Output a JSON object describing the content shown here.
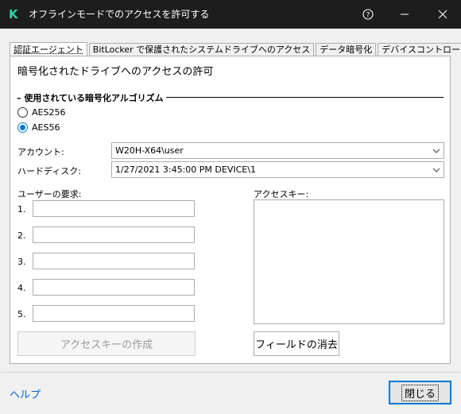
{
  "window": {
    "title": "オフラインモードでのアクセスを許可する",
    "app_logo": "K"
  },
  "tabs": [
    {
      "label": "認証エージェント",
      "active": true
    },
    {
      "label": "BitLocker で保護されたシステムドライブへのアクセス",
      "active": false
    },
    {
      "label": "データ暗号化",
      "active": false
    },
    {
      "label": "デバイスコントロール",
      "active": false
    }
  ],
  "panel": {
    "heading": "暗号化されたドライブへのアクセスの許可",
    "algorithm_group": {
      "title": "使用されている暗号化アルゴリズム",
      "options": [
        {
          "label": "AES256",
          "checked": false
        },
        {
          "label": "AES56",
          "checked": true
        }
      ]
    },
    "account": {
      "label": "アカウント:",
      "value": "W20H-X64\\user"
    },
    "hard_disk": {
      "label": "ハードディスク:",
      "value": "1/27/2021 3:45:00 PM  DEVICE\\1"
    },
    "user_request": {
      "label": "ユーザーの要求:",
      "fields": [
        {
          "num": "1.",
          "value": ""
        },
        {
          "num": "2.",
          "value": ""
        },
        {
          "num": "3.",
          "value": ""
        },
        {
          "num": "4.",
          "value": ""
        },
        {
          "num": "5.",
          "value": ""
        }
      ]
    },
    "access_key": {
      "label": "アクセスキー:",
      "value": ""
    },
    "create_key_button": "アクセスキーの作成",
    "clear_fields_button": "フィールドの消去"
  },
  "footer": {
    "help_link": "ヘルプ",
    "close_button": "閉じる"
  }
}
